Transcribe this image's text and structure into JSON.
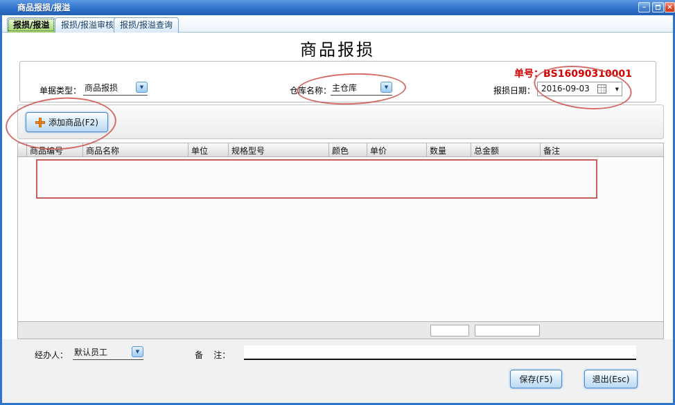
{
  "window": {
    "title": "商品报损/报溢",
    "controls": {
      "minimize": "–",
      "close": "×"
    }
  },
  "tabs": [
    {
      "label": "报损/报溢",
      "active": true
    },
    {
      "label": "报损/报溢审核",
      "active": false
    },
    {
      "label": "报损/报溢查询",
      "active": false
    }
  ],
  "page": {
    "title": "商品报损"
  },
  "header_panel": {
    "doc_no_label": "单号：",
    "doc_no": "BS16090310001",
    "doc_type_label": "单据类型：",
    "doc_type": "商品报损",
    "warehouse_label": "仓库名称：",
    "warehouse": "主仓库",
    "date_label": "报损日期：",
    "date": "2016-09-03"
  },
  "toolbar": {
    "add_product_button": "添加商品(F2)"
  },
  "table": {
    "headers": [
      "",
      "商品编号",
      "商品名称",
      "单位",
      "规格型号",
      "颜色",
      "单价",
      "数量",
      "总金额",
      "备注"
    ],
    "rows": []
  },
  "footer": {
    "operator_label": "经办人：",
    "operator": "默认员工",
    "remark_label": "备    注：",
    "remark": "",
    "save_button": "保存(F5)",
    "exit_button": "退出(Esc)"
  },
  "icons": {
    "dropdown_arrow": "▼"
  },
  "colors": {
    "titlebar_blue": "#2e74cc",
    "doc_no_red": "#d00000",
    "annotation_red": "#cb544e",
    "tab_active_green": "#9ed268"
  }
}
